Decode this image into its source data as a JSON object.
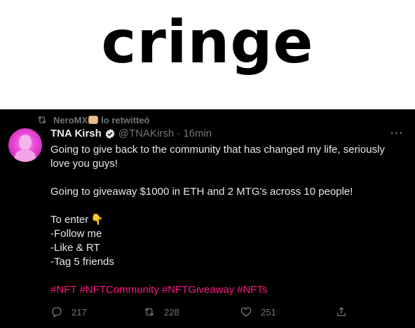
{
  "meme": {
    "caption": "cringe"
  },
  "retweet": {
    "user": "NeroMX",
    "text": "lo retwitteó"
  },
  "tweet": {
    "display_name": "TNA Kirsh",
    "handle": "@TNAKirsh",
    "separator": "·",
    "time": "16min",
    "lines": {
      "l1": "Going to give back to the community that has changed my life, seriously love you guys!",
      "l2": "Going to giveaway $1000 in ETH and 2 MTG's across 10 people!",
      "l3": "To enter",
      "l3_emoji": "👇",
      "l4": "-Follow me",
      "l5": "-Like & RT",
      "l6": "-Tag 5 friends"
    },
    "hashtags": [
      "#NFT",
      "#NFTCommunity",
      "#NFTGiveaway",
      "#NFTs"
    ],
    "more_label": "···"
  },
  "actions": {
    "replies": "217",
    "retweets": "228",
    "likes": "251"
  },
  "colors": {
    "background": "#000000",
    "hashtag": "#f91880",
    "muted": "#71767b",
    "text": "#e7e9ea",
    "verified_badge": "#e7e9ea"
  },
  "icons": [
    "retweet-icon",
    "verified-badge-icon",
    "more-icon",
    "reply-icon",
    "like-icon",
    "share-icon"
  ]
}
